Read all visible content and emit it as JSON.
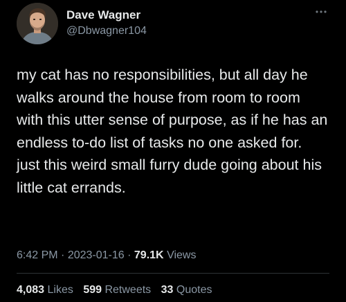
{
  "author": {
    "display_name": "Dave Wagner",
    "handle": "@Dbwagner104"
  },
  "icons": {
    "more": "more-options-icon",
    "avatar": "profile-photo"
  },
  "tweet": {
    "text": "my cat has no responsibilities, but all day he walks around the house from room to room with this utter sense of purpose, as if he has an endless to-do list of tasks no one asked for. just this weird small furry dude going about his little cat errands."
  },
  "meta": {
    "time": "6:42 PM",
    "separator": "·",
    "date": "2023-01-16",
    "views_count": "79.1K",
    "views_label": "Views"
  },
  "stats": {
    "likes_count": "4,083",
    "likes_label": "Likes",
    "retweets_count": "599",
    "retweets_label": "Retweets",
    "quotes_count": "33",
    "quotes_label": "Quotes"
  },
  "colors": {
    "background": "#000000",
    "primary_text": "#e7e9ea",
    "secondary_text": "#8b98a5",
    "divider": "#2f3336"
  }
}
